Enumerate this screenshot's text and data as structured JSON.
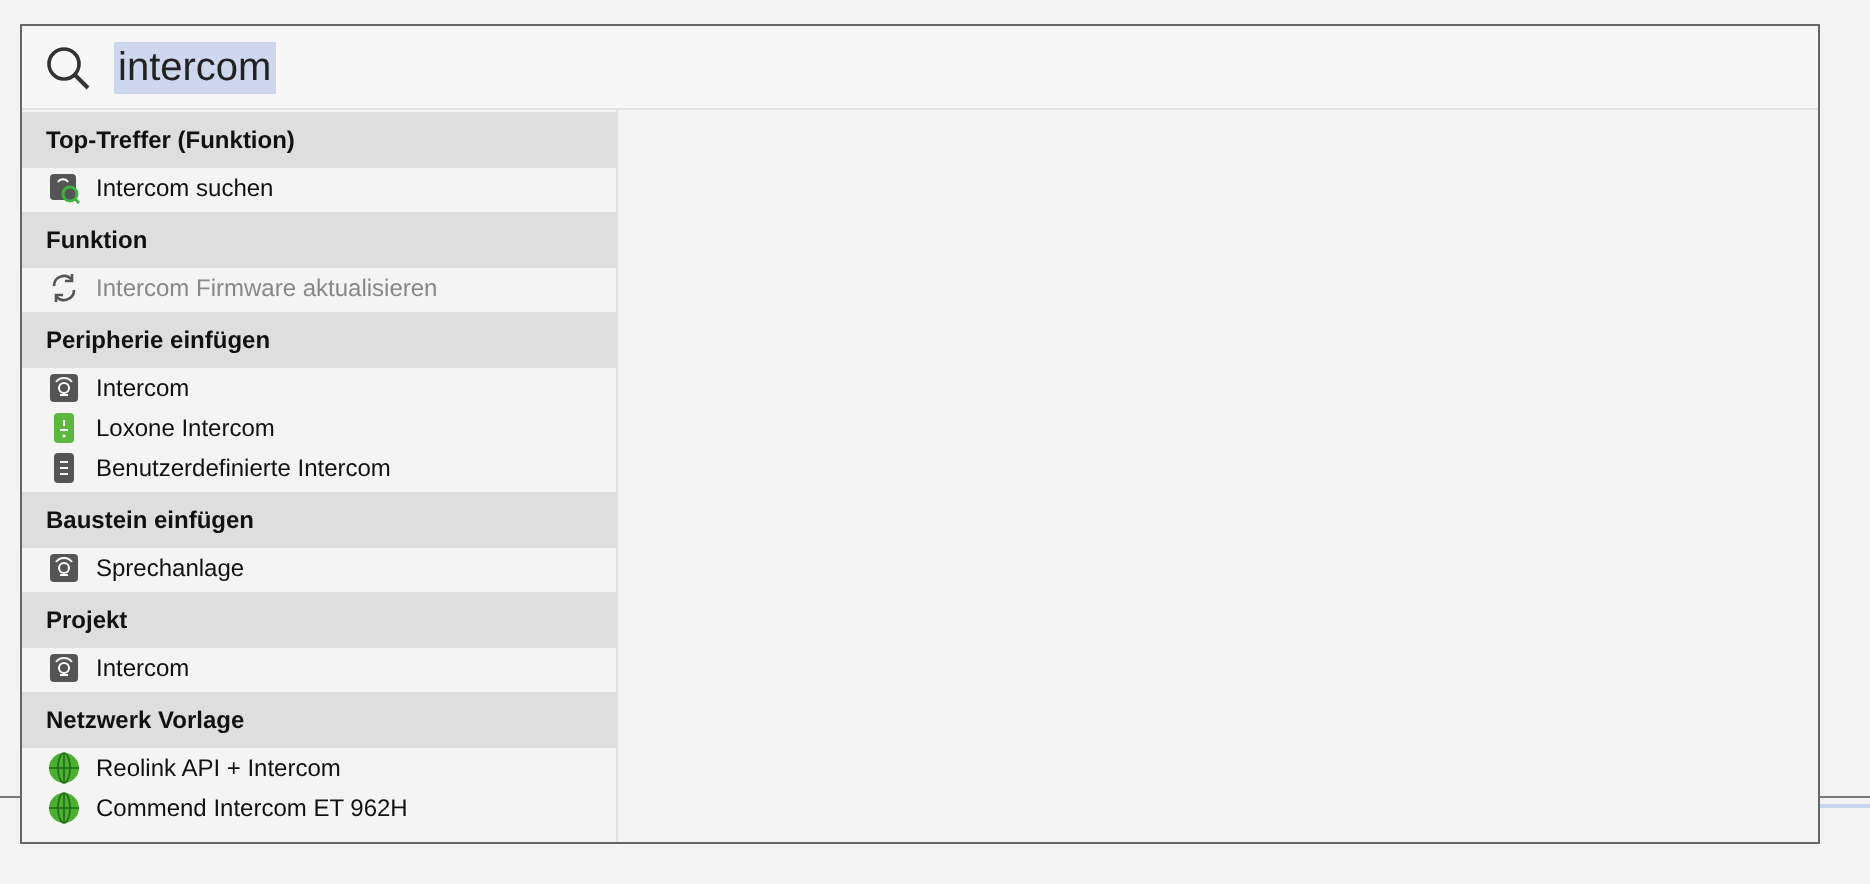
{
  "search": {
    "value": "intercom",
    "highlighted": true
  },
  "groups": [
    {
      "title": "Top-Treffer (Funktion)",
      "items": [
        {
          "label": "Intercom suchen",
          "kind": "search",
          "disabled": false
        }
      ]
    },
    {
      "title": "Funktion",
      "items": [
        {
          "label": "Intercom Firmware aktualisieren",
          "kind": "action",
          "disabled": true
        }
      ]
    },
    {
      "title": "Peripherie einfügen",
      "items": [
        {
          "label": "Intercom",
          "kind": "device",
          "disabled": false
        },
        {
          "label": "Loxone Intercom",
          "kind": "loxone",
          "disabled": false
        },
        {
          "label": "Benutzerdefinierte Intercom",
          "kind": "custom",
          "disabled": false
        }
      ]
    },
    {
      "title": "Baustein einfügen",
      "items": [
        {
          "label": "Sprechanlage",
          "kind": "device",
          "disabled": false
        }
      ]
    },
    {
      "title": "Projekt",
      "items": [
        {
          "label": "Intercom",
          "kind": "device",
          "disabled": false
        }
      ]
    },
    {
      "title": "Netzwerk Vorlage",
      "items": [
        {
          "label": "Reolink API + Intercom",
          "kind": "template",
          "disabled": false
        },
        {
          "label": "Commend Intercom ET 962H",
          "kind": "template",
          "disabled": false
        }
      ]
    }
  ]
}
